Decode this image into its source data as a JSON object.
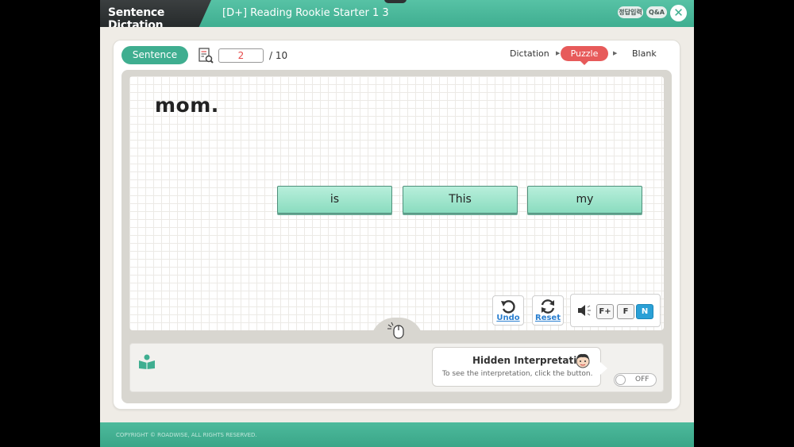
{
  "header": {
    "app_title": "Sentence Dictation",
    "lesson_title": "[D+] Reading Rookie Starter 1 3",
    "answer_pill": "정답입력",
    "qa_pill": "Q&A",
    "close_glyph": "✕"
  },
  "toolbar": {
    "sentence_label": "Sentence",
    "page_current": "2",
    "page_total": "/ 10",
    "tabs": [
      {
        "label": "Dictation",
        "active": false
      },
      {
        "label": "Puzzle",
        "active": true
      },
      {
        "label": "Blank",
        "active": false
      }
    ],
    "arrow_glyph": "▶"
  },
  "board": {
    "sentence": "mom.",
    "tiles": [
      "is",
      "This",
      "my"
    ]
  },
  "controls": {
    "undo_label": "Undo",
    "reset_label": "Reset",
    "speeds": [
      "F+",
      "F",
      "N"
    ],
    "active_speed": "N"
  },
  "interpretation": {
    "title": "Hidden Interpretation",
    "subtitle": "To see the interpretation, click the button.",
    "toggle_label": "OFF"
  },
  "footer": {
    "copyright": "COPYRIGHT © ROADWISE, ALL RIGHTS RESERVED."
  },
  "colors": {
    "brand_green": "#3fae90",
    "active_tab": "#e75a5a",
    "tile_green": "#8adcbf",
    "speed_active": "#2aa0d6"
  }
}
